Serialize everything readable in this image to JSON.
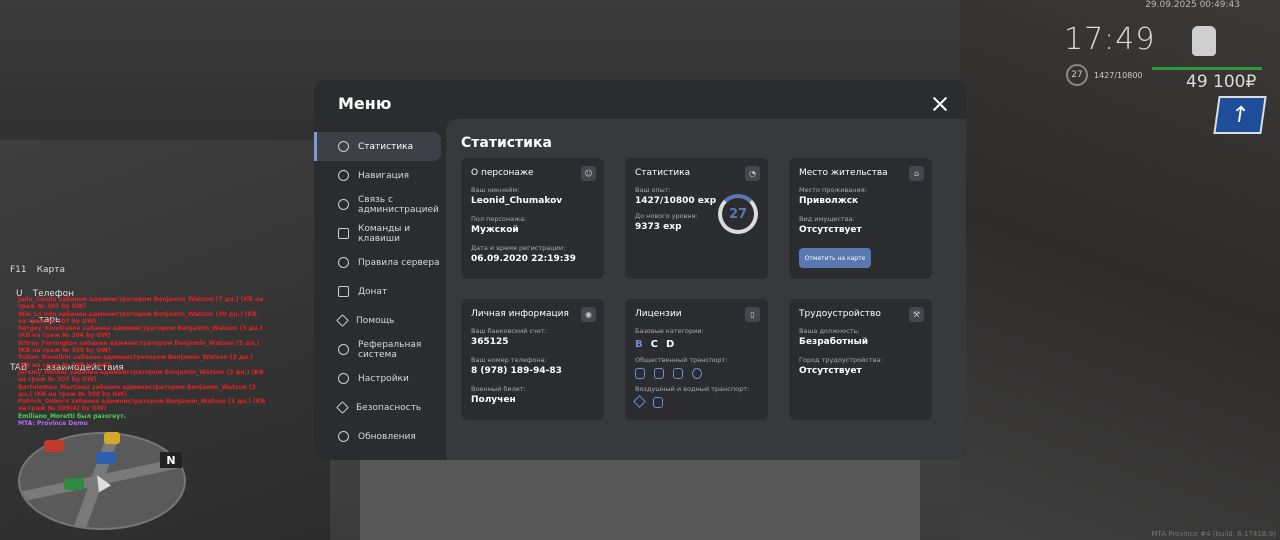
{
  "hud": {
    "datetime": "29.09.2025 00:49:43",
    "time": "17:49",
    "level": "27",
    "exp": "1427/10800",
    "money": "49 100₽",
    "sign_arrow": "arrow-up-icon",
    "build": "MTA Province #4 (build: 6.1741B.9)"
  },
  "left_hud": {
    "map_key": "F11",
    "map_label": "Карта",
    "phone_key": "U",
    "phone_label": "Телефон",
    "cursor_label": "...тарь",
    "tab_key": "TAB",
    "tab_label": "...взаимодействия",
    "minimap_north": "N"
  },
  "chat": [
    {
      "t": "Jada_Sanda забанен администратором Benjamin_Watson (7 дн.) (КБ на граж № 307 by GW)",
      "c": "red"
    },
    {
      "t": "Wie_Lo ndo забанен администратором Benjamin_Watson (30 дн.) (КБ на граж № 307 by GW)",
      "c": "red"
    },
    {
      "t": "Sergey_Kondrasov забанен администратором Benjamin_Watson (3 дн.) (КБ на граж № 304 by GW)",
      "c": "red"
    },
    {
      "t": "Nitray_Farrington забанен администратором Benjamin_Watson (5 дн.) (КБ на граж № 305 by GW)",
      "c": "red"
    },
    {
      "t": "Yuban_Ravelkin забанен администратором Benjamin_Watson (3 дн.) (КБ на граж № 309 by GW)",
      "c": "red"
    },
    {
      "t": "Jeremy_Hefner забанен администратором Benjamin_Watson (3 дн.) (КБ на граж № 307 by GW)",
      "c": "red"
    },
    {
      "t": "Bartolomeo_Martinez забанен администратором Benjamin_Watson (3 дн.) (КБ на граж № 308 by GW)",
      "c": "red"
    },
    {
      "t": "Patrick_Osborn забанен администратором Benjamin_Watson (3 дн.) (КБ на граж № 309(А) by GW)",
      "c": "red"
    },
    {
      "t": "Emiliano_Moretti был разогнут.",
      "c": "green"
    },
    {
      "t": "MTA: Province Demo",
      "c": "purple"
    }
  ],
  "menu": {
    "title": "Меню",
    "nav": [
      {
        "label": "Статистика",
        "icon": "pie-chart-icon",
        "active": true
      },
      {
        "label": "Навигация",
        "icon": "compass-icon"
      },
      {
        "label": "Связь с администрацией",
        "icon": "headset-icon"
      },
      {
        "label": "Команды и клавиши",
        "icon": "document-icon"
      },
      {
        "label": "Правила сервера",
        "icon": "scales-icon"
      },
      {
        "label": "Донат",
        "icon": "wallet-icon"
      },
      {
        "label": "Помощь",
        "icon": "heart-icon"
      },
      {
        "label": "Реферальная система",
        "icon": "network-icon"
      },
      {
        "label": "Настройки",
        "icon": "gear-icon"
      },
      {
        "label": "Безопасность",
        "icon": "shield-icon"
      },
      {
        "label": "Обновления",
        "icon": "refresh-icon"
      }
    ],
    "content_title": "Статистика",
    "cards": {
      "character": {
        "title": "О персонаже",
        "icon": "user-icon",
        "nick_label": "Ваш никнейм:",
        "nick": "Leonid_Chumakov",
        "gender_label": "Пол персонажа:",
        "gender": "Мужской",
        "reg_label": "Дата и время регистрации:",
        "reg": "06.09.2020 22:19:39"
      },
      "stats": {
        "title": "Статистика",
        "icon": "pie-chart-icon",
        "exp_label": "Ваш опыт:",
        "exp": "1427/10800 exp",
        "next_label": "До нового уровня:",
        "next": "9373 exp",
        "level": "27",
        "level_progress": 0.132
      },
      "residence": {
        "title": "Место жительства",
        "icon": "home-icon",
        "place_label": "Место проживания:",
        "place": "Приволжск",
        "property_label": "Вид имущества:",
        "property": "Отсутствует",
        "button": "Отметить на карте"
      },
      "personal": {
        "title": "Личная информация",
        "icon": "user-circle-icon",
        "bank_label": "Ваш банковский счет:",
        "bank": "365125",
        "phone_label": "Ваш номер телефона:",
        "phone": "8 (978) 189-94-83",
        "military_label": "Военный билет:",
        "military": "Получен"
      },
      "licenses": {
        "title": "Лицензии",
        "icon": "license-icon",
        "basic_label": "Базовые категории:",
        "categories": [
          "B",
          "C",
          "D"
        ],
        "public_label": "Общественный транспорт:",
        "public_icons": [
          "bus-icon",
          "trolleybus-icon",
          "tram-icon",
          "train-icon"
        ],
        "air_label": "Воздушный и водный транспорт:",
        "air_icons": [
          "plane-icon",
          "boat-icon"
        ]
      },
      "employment": {
        "title": "Трудоустройство",
        "icon": "tools-icon",
        "position_label": "Ваша должность:",
        "position": "Безработный",
        "city_label": "Город трудоустройства:",
        "city": "Отсутствует"
      }
    }
  }
}
